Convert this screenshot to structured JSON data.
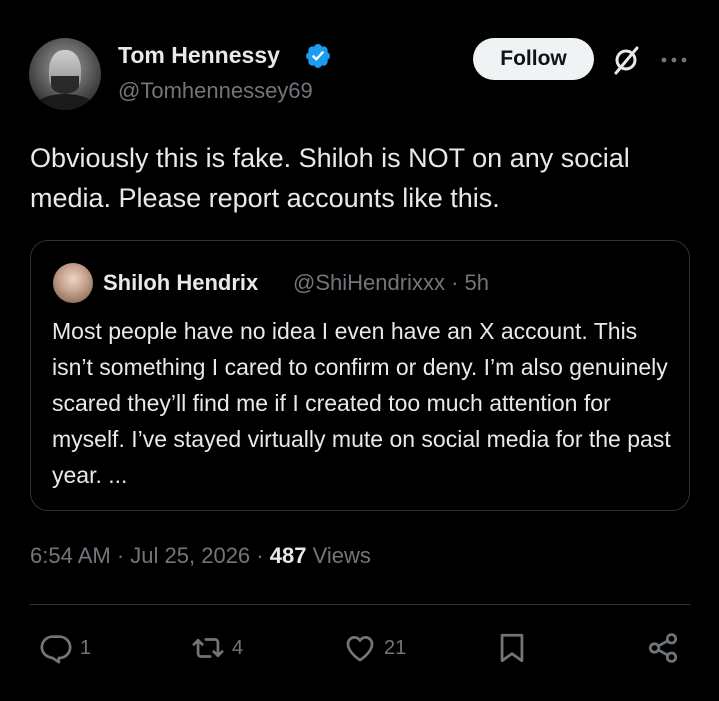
{
  "author": {
    "name": "Tom Hennessy",
    "handle": "@Tomhennessey69",
    "verified": true
  },
  "follow_label": "Follow",
  "tweet_text": "Obviously this is fake. Shiloh is NOT on any social media. Please report accounts like this.",
  "quote": {
    "name": "Shiloh Hendrix",
    "handle": "@ShiHendrixxx",
    "time": "· 5h",
    "text": "Most people have no idea I even have an X account. This isn’t something I cared to confirm or deny. I’m also genuinely scared they’ll find me if I created too much attention for myself. I’ve stayed virtually mute on social media for the past year. ..."
  },
  "meta": {
    "time": "6:54 AM",
    "date": "Jul 25, 2026",
    "views_count": "487",
    "views_label": "Views"
  },
  "actions": {
    "replies": "1",
    "reposts": "4",
    "likes": "21"
  },
  "icons": {
    "verified": "verified-badge-icon",
    "grok": "grok-icon",
    "more": "more-icon",
    "reply": "reply-icon",
    "repost": "repost-icon",
    "like": "heart-icon",
    "bookmark": "bookmark-icon",
    "share": "share-icon"
  },
  "colors": {
    "background": "#000000",
    "text": "#e7e9ea",
    "muted": "#71767b",
    "verified": "#1d9bf0",
    "border": "#2f3336"
  }
}
